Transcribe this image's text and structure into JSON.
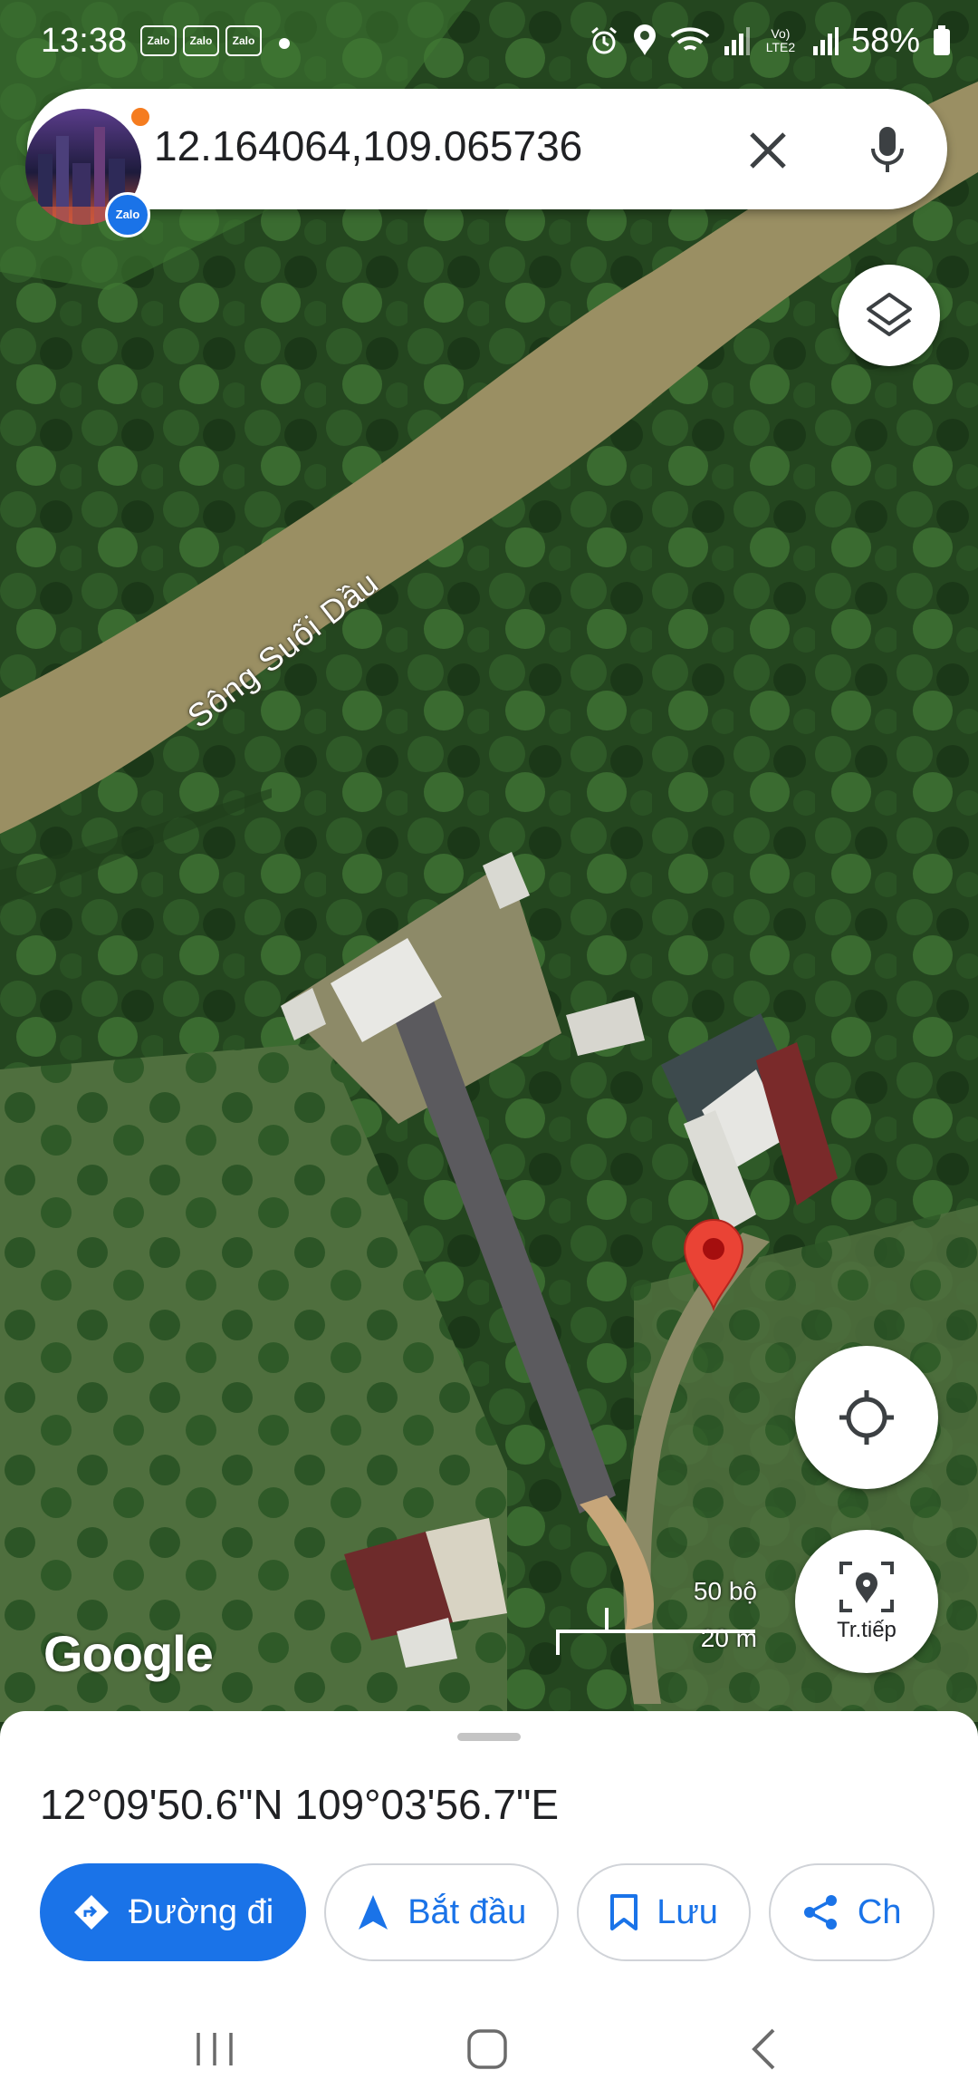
{
  "status_bar": {
    "time": "13:38",
    "notification_apps": [
      "Zalo",
      "Zalo",
      "Zalo"
    ],
    "battery_percent": "58%",
    "network_label": "Vo) LTE2"
  },
  "search": {
    "query": "12.164064,109.065736",
    "avatar_badge": "Zalo"
  },
  "map": {
    "river_label": "Sông Suối Dầu",
    "google_logo": "Google",
    "scale_top": "50 bộ",
    "scale_bottom": "20 m",
    "explore_label": "Tr.tiếp"
  },
  "place_sheet": {
    "coordinates_dms": "12°09'50.6\"N 109°03'56.7\"E",
    "actions": {
      "directions": "Đường đi",
      "start": "Bắt đầu",
      "save": "Lưu",
      "share": "Ch"
    }
  },
  "colors": {
    "accent": "#1a73e8",
    "pin": "#ea4335"
  }
}
